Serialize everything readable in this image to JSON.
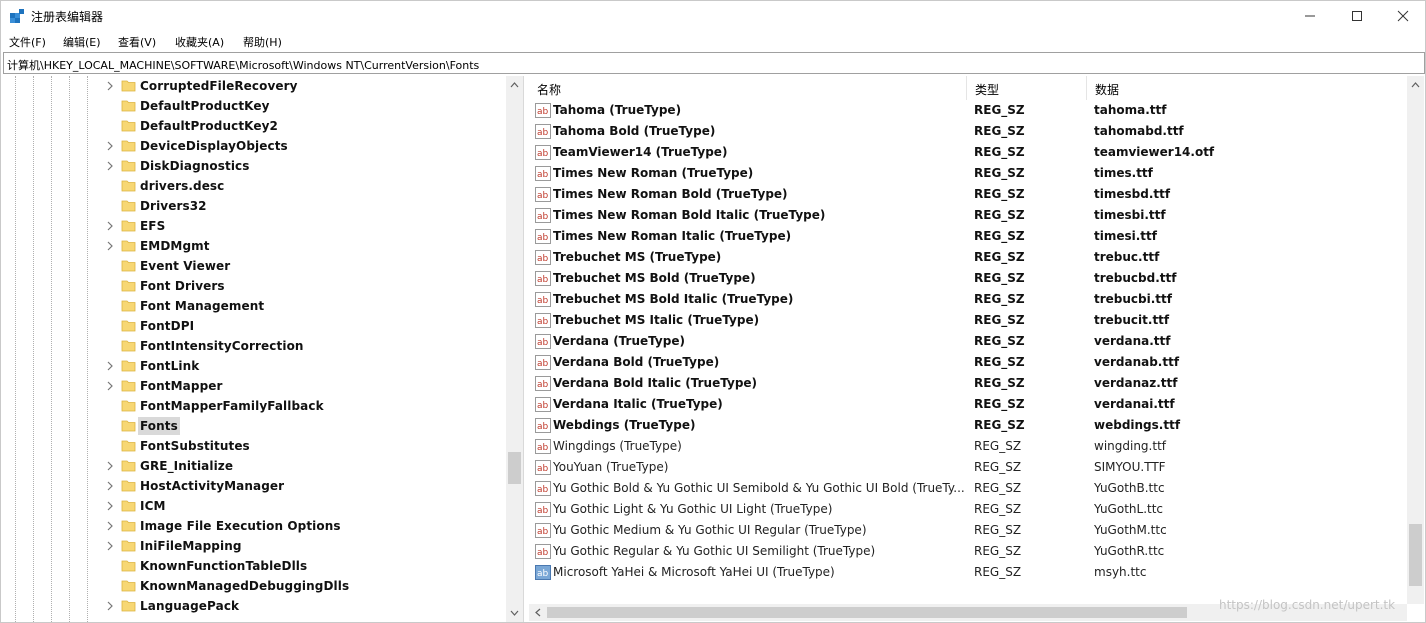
{
  "window": {
    "title": "注册表编辑器",
    "minimize_icon": "minimize-icon",
    "maximize_icon": "maximize-icon",
    "close_icon": "close-icon"
  },
  "menu": [
    "文件(F)",
    "编辑(E)",
    "查看(V)",
    "收藏夹(A)",
    "帮助(H)"
  ],
  "address": "计算机\\HKEY_LOCAL_MACHINE\\SOFTWARE\\Microsoft\\Windows NT\\CurrentVersion\\Fonts",
  "tree": {
    "selected": "Fonts",
    "items": [
      {
        "label": "CorruptedFileRecovery",
        "expandable": true
      },
      {
        "label": "DefaultProductKey",
        "expandable": false
      },
      {
        "label": "DefaultProductKey2",
        "expandable": false
      },
      {
        "label": "DeviceDisplayObjects",
        "expandable": true
      },
      {
        "label": "DiskDiagnostics",
        "expandable": true
      },
      {
        "label": "drivers.desc",
        "expandable": false
      },
      {
        "label": "Drivers32",
        "expandable": false
      },
      {
        "label": "EFS",
        "expandable": true
      },
      {
        "label": "EMDMgmt",
        "expandable": true
      },
      {
        "label": "Event Viewer",
        "expandable": false
      },
      {
        "label": "Font Drivers",
        "expandable": false
      },
      {
        "label": "Font Management",
        "expandable": false
      },
      {
        "label": "FontDPI",
        "expandable": false
      },
      {
        "label": "FontIntensityCorrection",
        "expandable": false
      },
      {
        "label": "FontLink",
        "expandable": true
      },
      {
        "label": "FontMapper",
        "expandable": true
      },
      {
        "label": "FontMapperFamilyFallback",
        "expandable": false
      },
      {
        "label": "Fonts",
        "expandable": false
      },
      {
        "label": "FontSubstitutes",
        "expandable": false
      },
      {
        "label": "GRE_Initialize",
        "expandable": true
      },
      {
        "label": "HostActivityManager",
        "expandable": true
      },
      {
        "label": "ICM",
        "expandable": true
      },
      {
        "label": "Image File Execution Options",
        "expandable": true
      },
      {
        "label": "IniFileMapping",
        "expandable": true
      },
      {
        "label": "KnownFunctionTableDlls",
        "expandable": false
      },
      {
        "label": "KnownManagedDebuggingDlls",
        "expandable": false
      },
      {
        "label": "LanguagePack",
        "expandable": true
      }
    ]
  },
  "columns": {
    "name": "名称",
    "type": "类型",
    "data": "数据"
  },
  "values": [
    {
      "name": "Tahoma (TrueType)",
      "type": "REG_SZ",
      "data": "tahoma.ttf",
      "style": "bold",
      "icon": "string-value-icon"
    },
    {
      "name": "Tahoma Bold (TrueType)",
      "type": "REG_SZ",
      "data": "tahomabd.ttf",
      "style": "bold",
      "icon": "string-value-icon"
    },
    {
      "name": "TeamViewer14 (TrueType)",
      "type": "REG_SZ",
      "data": "teamviewer14.otf",
      "style": "bold",
      "icon": "string-value-icon"
    },
    {
      "name": "Times New Roman (TrueType)",
      "type": "REG_SZ",
      "data": "times.ttf",
      "style": "bold",
      "icon": "string-value-icon"
    },
    {
      "name": "Times New Roman Bold (TrueType)",
      "type": "REG_SZ",
      "data": "timesbd.ttf",
      "style": "bold",
      "icon": "string-value-icon"
    },
    {
      "name": "Times New Roman Bold Italic (TrueType)",
      "type": "REG_SZ",
      "data": "timesbi.ttf",
      "style": "bold",
      "icon": "string-value-icon"
    },
    {
      "name": "Times New Roman Italic (TrueType)",
      "type": "REG_SZ",
      "data": "timesi.ttf",
      "style": "bold",
      "icon": "string-value-icon"
    },
    {
      "name": "Trebuchet MS (TrueType)",
      "type": "REG_SZ",
      "data": "trebuc.ttf",
      "style": "bold",
      "icon": "string-value-icon"
    },
    {
      "name": "Trebuchet MS Bold (TrueType)",
      "type": "REG_SZ",
      "data": "trebucbd.ttf",
      "style": "bold",
      "icon": "string-value-icon"
    },
    {
      "name": "Trebuchet MS Bold Italic (TrueType)",
      "type": "REG_SZ",
      "data": "trebucbi.ttf",
      "style": "bold",
      "icon": "string-value-icon"
    },
    {
      "name": "Trebuchet MS Italic (TrueType)",
      "type": "REG_SZ",
      "data": "trebucit.ttf",
      "style": "bold",
      "icon": "string-value-icon"
    },
    {
      "name": "Verdana (TrueType)",
      "type": "REG_SZ",
      "data": "verdana.ttf",
      "style": "bold",
      "icon": "string-value-icon"
    },
    {
      "name": "Verdana Bold (TrueType)",
      "type": "REG_SZ",
      "data": "verdanab.ttf",
      "style": "bold",
      "icon": "string-value-icon"
    },
    {
      "name": "Verdana Bold Italic (TrueType)",
      "type": "REG_SZ",
      "data": "verdanaz.ttf",
      "style": "bold",
      "icon": "string-value-icon"
    },
    {
      "name": "Verdana Italic (TrueType)",
      "type": "REG_SZ",
      "data": "verdanai.ttf",
      "style": "bold",
      "icon": "string-value-icon"
    },
    {
      "name": "Webdings (TrueType)",
      "type": "REG_SZ",
      "data": "webdings.ttf",
      "style": "bold",
      "icon": "string-value-icon"
    },
    {
      "name": "Wingdings (TrueType)",
      "type": "REG_SZ",
      "data": "wingding.ttf",
      "style": "normal",
      "icon": "string-value-icon"
    },
    {
      "name": "YouYuan (TrueType)",
      "type": "REG_SZ",
      "data": "SIMYOU.TTF",
      "style": "normal",
      "icon": "string-value-icon"
    },
    {
      "name": "Yu Gothic Bold & Yu Gothic UI Semibold & Yu Gothic UI Bold (TrueTy...",
      "type": "REG_SZ",
      "data": "YuGothB.ttc",
      "style": "normal",
      "icon": "string-value-icon"
    },
    {
      "name": "Yu Gothic Light & Yu Gothic UI Light (TrueType)",
      "type": "REG_SZ",
      "data": "YuGothL.ttc",
      "style": "normal",
      "icon": "string-value-icon"
    },
    {
      "name": "Yu Gothic Medium & Yu Gothic UI Regular (TrueType)",
      "type": "REG_SZ",
      "data": "YuGothM.ttc",
      "style": "normal",
      "icon": "string-value-icon"
    },
    {
      "name": "Yu Gothic Regular & Yu Gothic UI Semilight (TrueType)",
      "type": "REG_SZ",
      "data": "YuGothR.ttc",
      "style": "normal",
      "icon": "string-value-icon"
    },
    {
      "name": "Microsoft YaHei & Microsoft YaHei UI (TrueType)",
      "type": "REG_SZ",
      "data": "msyh.ttc",
      "style": "normal",
      "icon": "string-value-selected-icon"
    }
  ],
  "watermark": "https://blog.csdn.net/upert.tk"
}
